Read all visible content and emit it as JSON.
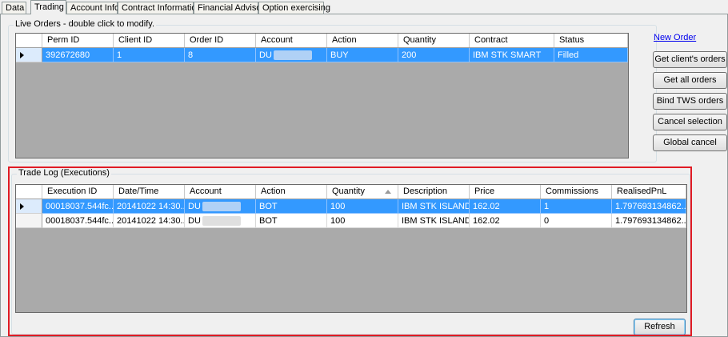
{
  "tabs": [
    {
      "label": "Data",
      "active": false
    },
    {
      "label": "Trading",
      "active": true
    },
    {
      "label": "Account Info",
      "active": false
    },
    {
      "label": "Contract Information",
      "active": false
    },
    {
      "label": "Financial Advisor",
      "active": false
    },
    {
      "label": "Option exercising",
      "active": false
    }
  ],
  "live_orders": {
    "title": "Live Orders - double click to modify.",
    "columns": [
      "Perm ID",
      "Client ID",
      "Order ID",
      "Account",
      "Action",
      "Quantity",
      "Contract",
      "Status"
    ],
    "rows": [
      {
        "perm_id": "392672680",
        "client_id": "1",
        "order_id": "8",
        "account": "DU",
        "action": "BUY",
        "quantity": "200",
        "contract": "IBM STK SMART",
        "status": "Filled"
      }
    ]
  },
  "side_actions": {
    "new_order": "New Order",
    "get_clients_orders": "Get client's orders",
    "get_all_orders": "Get all orders",
    "bind_tws_orders": "Bind TWS orders",
    "cancel_selection": "Cancel selection",
    "global_cancel": "Global cancel"
  },
  "trade_log": {
    "title": "Trade Log (Executions)",
    "columns": [
      "Execution ID",
      "Date/Time",
      "Account",
      "Action",
      "Quantity",
      "Description",
      "Price",
      "Commissions",
      "RealisedPnL"
    ],
    "rows": [
      {
        "execution_id": "00018037.544fc...",
        "datetime": "20141022  14:30...",
        "account": "DU",
        "action": "BOT",
        "quantity": "100",
        "description": "IBM STK ISLAND",
        "price": "162.02",
        "commissions": "1",
        "realised_pnl": "1.797693134862..."
      },
      {
        "execution_id": "00018037.544fc...",
        "datetime": "20141022  14:30...",
        "account": "DU",
        "action": "BOT",
        "quantity": "100",
        "description": "IBM STK ISLAND",
        "price": "162.02",
        "commissions": "0",
        "realised_pnl": "1.797693134862..."
      }
    ],
    "refresh_label": "Refresh"
  },
  "colors": {
    "selection": "#3399ff",
    "highlight": "#e01b24",
    "grid_background": "#aaaaaa"
  }
}
